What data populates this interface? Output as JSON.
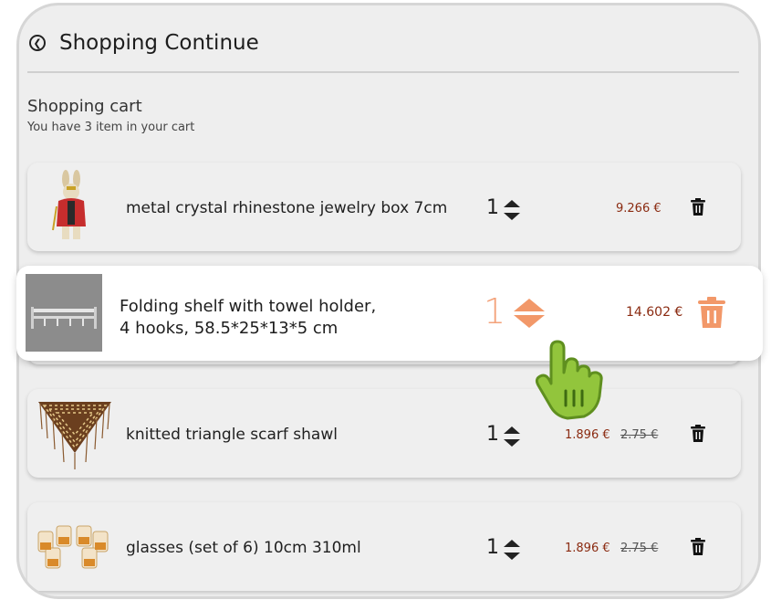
{
  "header": {
    "back_icon": "chevron-left-circle-icon",
    "title": "Shopping Continue"
  },
  "cart": {
    "title": "Shopping cart",
    "subtitle": "You have 3 item in your cart"
  },
  "items": [
    {
      "name": "metal crystal rhinestone jewelry box 7cm",
      "quantity": "1",
      "price": "9.266 €",
      "old_price": ""
    },
    {
      "name_line1": "Folding shelf with towel holder,",
      "name_line2": "4 hooks, 58.5*25*13*5 cm",
      "quantity": "1",
      "price": "14.602 €",
      "old_price": ""
    },
    {
      "name": "knitted triangle scarf shawl",
      "quantity": "1",
      "price": "1.896 €",
      "old_price": "2.75 €"
    },
    {
      "name": "glasses (set of 6) 10cm 310ml",
      "quantity": "1",
      "price": "1.896 €",
      "old_price": "2.75 €"
    }
  ],
  "colors": {
    "accent": "#f29869",
    "price": "#8a2a10",
    "background": "#eeeeee"
  }
}
